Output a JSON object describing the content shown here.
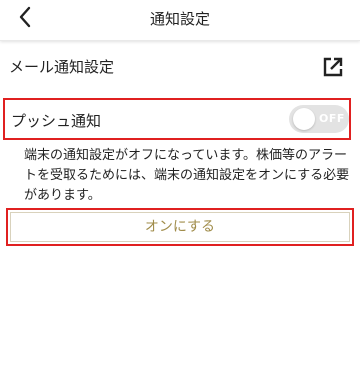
{
  "header": {
    "title": "通知設定",
    "back_icon": "chevron-left-icon"
  },
  "mail": {
    "label": "メール通知設定",
    "icon": "external-link-icon"
  },
  "push": {
    "label": "プッシュ通知",
    "toggle_state": "OFF",
    "toggle_on": false
  },
  "notice": {
    "text": "端末の通知設定がオフになっています。株価等のアラートを受取るためには、端末の通知設定をオンにする必要があります。"
  },
  "turn_on_button": {
    "label": "オンにする"
  },
  "colors": {
    "highlight_border": "#e02020",
    "button_text": "#a08c4a",
    "toggle_off_bg": "#e3e3e3"
  }
}
